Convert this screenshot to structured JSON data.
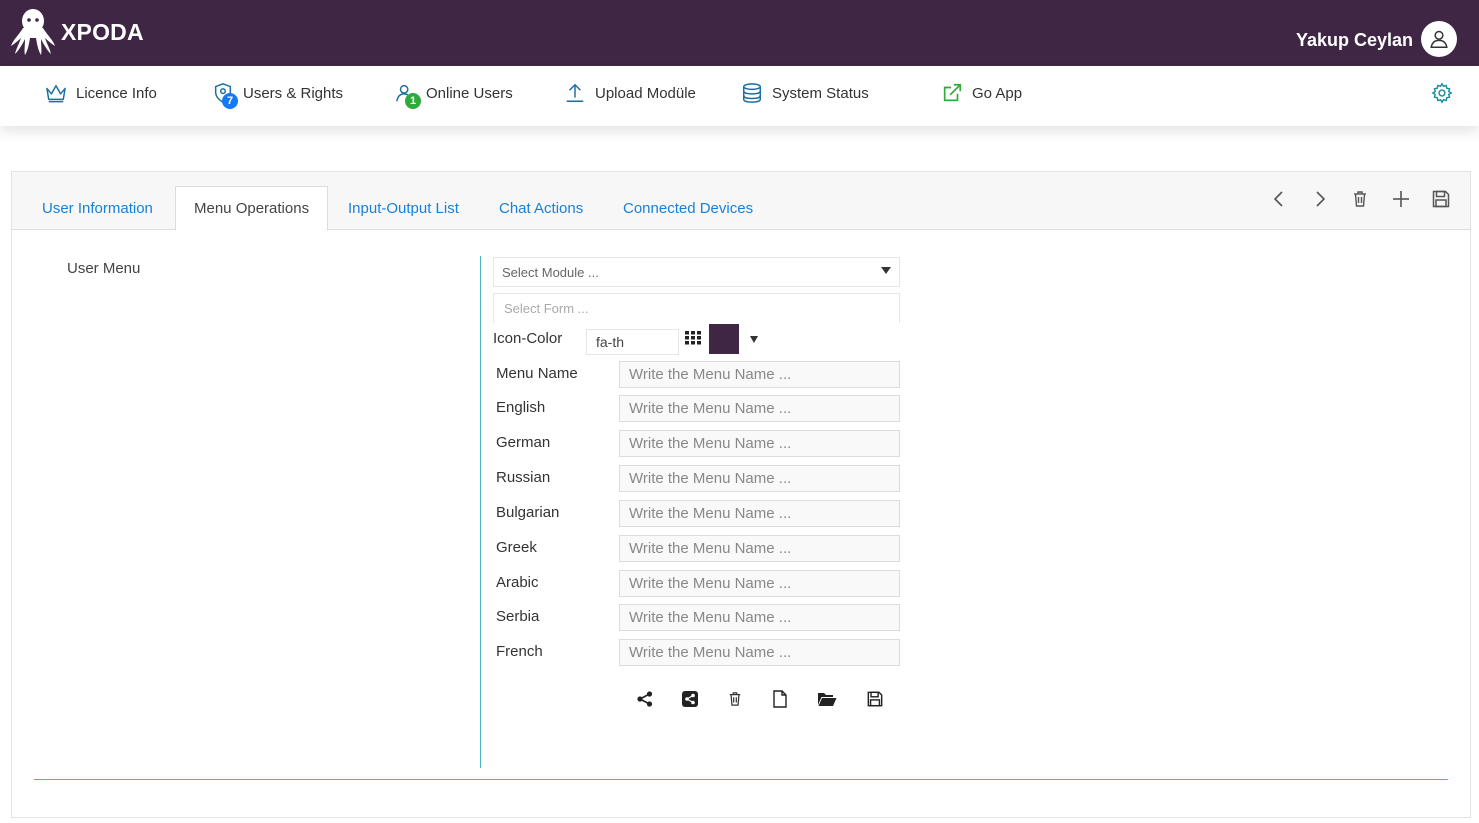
{
  "app": {
    "brand": "XPODA",
    "user_name": "Yakup Ceylan"
  },
  "nav": {
    "items": [
      {
        "label": "Licence Info",
        "icon": "crown-icon"
      },
      {
        "label": "Users & Rights",
        "icon": "shield-users-icon",
        "badge": "7"
      },
      {
        "label": "Online Users",
        "icon": "user-online-icon",
        "badge": "1"
      },
      {
        "label": "Upload Modüle",
        "icon": "upload-icon"
      },
      {
        "label": "System Status",
        "icon": "database-icon"
      },
      {
        "label": "Go App",
        "icon": "external-link-icon"
      }
    ],
    "settings_icon": "gear-icon"
  },
  "tabs": [
    {
      "label": "User Information",
      "active": false
    },
    {
      "label": "Menu Operations",
      "active": true
    },
    {
      "label": "Input-Output List",
      "active": false
    },
    {
      "label": "Chat Actions",
      "active": false
    },
    {
      "label": "Connected Devices",
      "active": false
    }
  ],
  "toolbar": [
    "chevron-left-icon",
    "chevron-right-icon",
    "trash-icon",
    "plus-icon",
    "save-icon"
  ],
  "user_menu": {
    "label": "User Menu"
  },
  "form": {
    "module_placeholder": "Select Module ...",
    "form_placeholder": "Select Form ...",
    "icon_color_label": "Icon-Color",
    "icon_value": "fa-th",
    "color": "#3f2645",
    "rows": [
      {
        "label": "Menu Name",
        "placeholder": "Write the Menu Name ..."
      },
      {
        "label": "English",
        "placeholder": "Write the Menu Name ..."
      },
      {
        "label": "German",
        "placeholder": "Write the Menu Name ..."
      },
      {
        "label": "Russian",
        "placeholder": "Write the Menu Name ..."
      },
      {
        "label": "Bulgarian",
        "placeholder": "Write the Menu Name ..."
      },
      {
        "label": "Greek",
        "placeholder": "Write the Menu Name ..."
      },
      {
        "label": "Arabic",
        "placeholder": "Write the Menu Name ..."
      },
      {
        "label": "Serbia",
        "placeholder": "Write the Menu Name ..."
      },
      {
        "label": "French",
        "placeholder": "Write the Menu Name ..."
      }
    ],
    "actions": [
      "share-icon",
      "share-square-icon",
      "trash-icon",
      "file-icon",
      "folder-open-icon",
      "save-icon"
    ]
  },
  "colors": {
    "header_bg": "#3f2645",
    "link": "#1a7fd6",
    "accent_line": "#4ab6c4",
    "badge_blue": "#1479f3",
    "badge_green": "#2eaa3a"
  }
}
